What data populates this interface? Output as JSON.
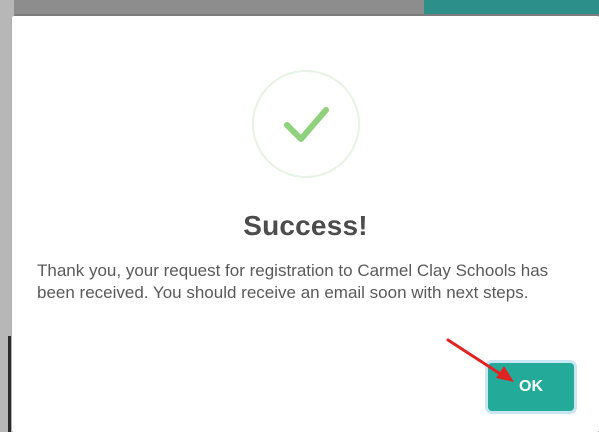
{
  "dialog": {
    "title": "Success!",
    "message": "Thank you, your request for registration to Carmel Clay Schools has been received. You should receive an email soon with next steps.",
    "ok_label": "OK",
    "icon": "check-icon"
  },
  "colors": {
    "accent": "#24aa98",
    "check": "#8fd17c",
    "annotation": "#e02424"
  }
}
